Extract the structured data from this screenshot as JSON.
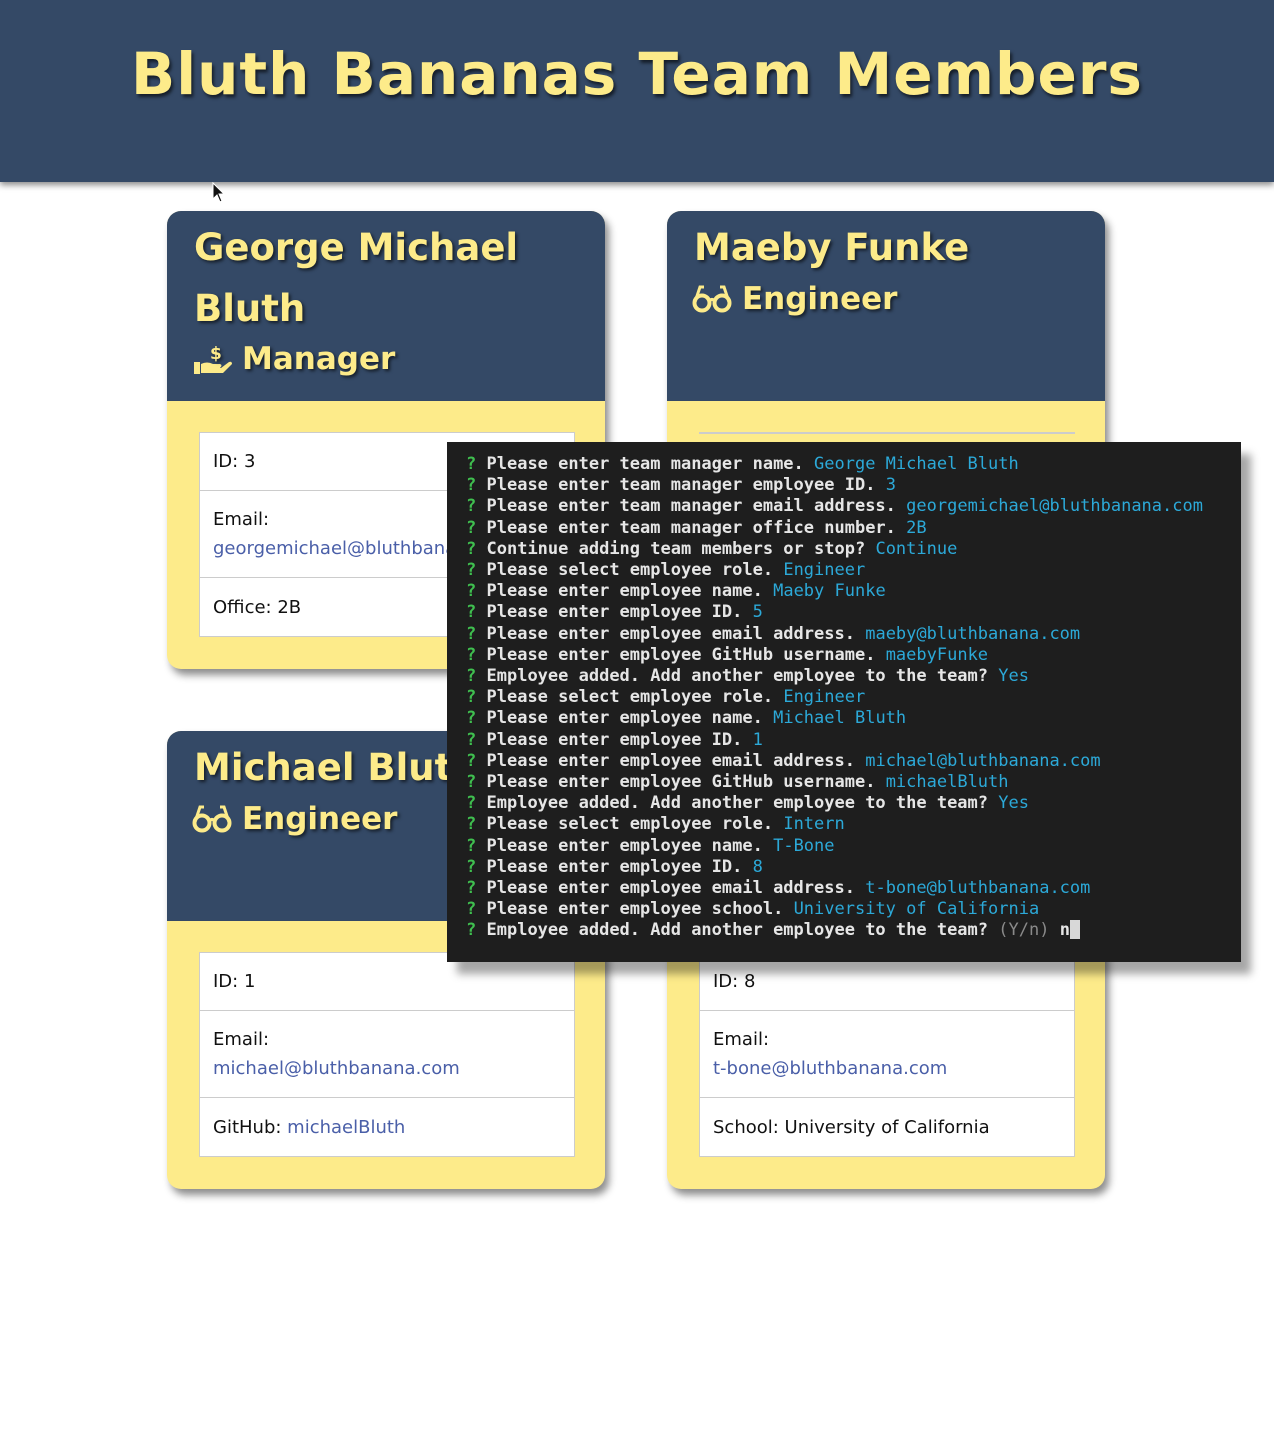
{
  "header": {
    "title": "Bluth Bananas Team Members"
  },
  "cards": [
    {
      "name": "George Michael Bluth",
      "role": "Manager",
      "role_icon": "hand-holding-dollar-icon",
      "id_text": "ID: 3",
      "email_label": "Email:",
      "email": "georgemichael@bluthbanana.com",
      "extra_label": "Office: 2B",
      "extra_value": ""
    },
    {
      "name": "Maeby Funke",
      "role": "Engineer",
      "role_icon": "glasses-icon"
    },
    {
      "name": "Michael Bluth",
      "role": "Engineer",
      "role_icon": "glasses-icon",
      "id_text": "ID: 1",
      "email_label": "Email:",
      "email": "michael@bluthbanana.com",
      "extra_label": "GitHub: ",
      "extra_value": "michaelBluth"
    },
    {
      "name": "",
      "role": "",
      "id_text": "ID: 8",
      "email_label": "Email:",
      "email": "t-bone@bluthbanana.com",
      "extra_label": "School: University of California",
      "extra_value": ""
    }
  ],
  "terminal": {
    "prefix": "?",
    "lines": [
      {
        "prompt": "Please enter team manager name.",
        "answer": "George Michael Bluth"
      },
      {
        "prompt": "Please enter team manager employee ID.",
        "answer": "3"
      },
      {
        "prompt": "Please enter team manager email address.",
        "answer": "georgemichael@bluthbanana.com"
      },
      {
        "prompt": "Please enter team manager office number.",
        "answer": "2B"
      },
      {
        "prompt": "Continue adding team members or stop?",
        "answer": "Continue"
      },
      {
        "prompt": "Please select employee role.",
        "answer": "Engineer"
      },
      {
        "prompt": "Please enter employee name.",
        "answer": "Maeby Funke"
      },
      {
        "prompt": "Please enter employee ID.",
        "answer": "5"
      },
      {
        "prompt": "Please enter employee email address.",
        "answer": "maeby@bluthbanana.com"
      },
      {
        "prompt": "Please enter employee GitHub username.",
        "answer": "maebyFunke"
      },
      {
        "prompt": "Employee added. Add another employee to the team?",
        "answer": "Yes"
      },
      {
        "prompt": "Please select employee role.",
        "answer": "Engineer"
      },
      {
        "prompt": "Please enter employee name.",
        "answer": "Michael Bluth"
      },
      {
        "prompt": "Please enter employee ID.",
        "answer": "1"
      },
      {
        "prompt": "Please enter employee email address.",
        "answer": "michael@bluthbanana.com"
      },
      {
        "prompt": "Please enter employee GitHub username.",
        "answer": "michaelBluth"
      },
      {
        "prompt": "Employee added. Add another employee to the team?",
        "answer": "Yes"
      },
      {
        "prompt": "Please select employee role.",
        "answer": "Intern"
      },
      {
        "prompt": "Please enter employee name.",
        "answer": "T-Bone"
      },
      {
        "prompt": "Please enter employee ID.",
        "answer": "8"
      },
      {
        "prompt": "Please enter employee email address.",
        "answer": "t-bone@bluthbanana.com"
      },
      {
        "prompt": "Please enter employee school.",
        "answer": "University of California"
      }
    ],
    "current": {
      "prompt": "Employee added. Add another employee to the team?",
      "hint": "(Y/n)",
      "typed": "n"
    }
  },
  "colors": {
    "header_bg": "#344966",
    "accent_yellow": "#fdeb8a",
    "link": "#4a5fa8",
    "terminal_bg": "#1e1e1e",
    "terminal_answer": "#2ca9d8",
    "terminal_q": "#3fbf4f"
  }
}
